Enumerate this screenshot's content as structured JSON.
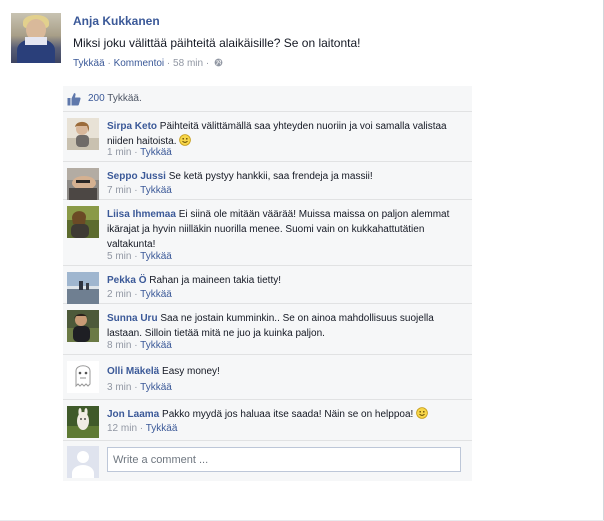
{
  "post": {
    "author": "Anja Kukkanen",
    "text": "Miksi joku välittää päihteitä alaikäisille? Se on laitonta!",
    "like_label": "Tykkää",
    "comment_label": "Kommentoi",
    "separator": " · ",
    "time": "58 min"
  },
  "likes": {
    "count": "200",
    "label": "Tykkää."
  },
  "comments": [
    {
      "name": "Sirpa Keto",
      "text": "Päihteitä välittämällä saa yhteyden nuoriin ja voi samalla valistaa niiden haitoista.",
      "emoticon": "smiley-emoticon",
      "time": "1 min",
      "like_label": "Tykkää"
    },
    {
      "name": "Seppo Jussi",
      "text": "Se ketä pystyy hankkii, saa frendeja ja massii!",
      "time": "7 min",
      "like_label": "Tykkää"
    },
    {
      "name": "Liisa Ihmemaa",
      "text": "Ei siinä ole mitään väärää! Muissa maissa on paljon alemmat ikärajat ja hyvin niilläkin nuorilla menee. Suomi vain on kukkahattutätien valtakunta!",
      "time": "5 min",
      "like_label": "Tykkää"
    },
    {
      "name": "Pekka Ö",
      "text": "Rahan ja maineen takia tietty!",
      "time": "2 min",
      "like_label": "Tykkää"
    },
    {
      "name": "Sunna Uru",
      "text": "Saa ne jostain kumminkin.. Se on ainoa mahdollisuus suojella lastaan. Silloin tietää mitä ne juo ja kuinka paljon.",
      "time": "8 min",
      "like_label": "Tykkää"
    },
    {
      "name": "Olli Mäkelä",
      "text": "Easy money!",
      "time": "3 min",
      "like_label": "Tykkää"
    },
    {
      "name": "Jon Laama",
      "text": "Pakko myydä jos haluaa itse saada! Näin se on helppoa!",
      "emoticon": "smiley-emoticon",
      "time": "12 min",
      "like_label": "Tykkää"
    }
  ],
  "composer": {
    "placeholder": "Write a comment ..."
  },
  "colors": {
    "link": "#3b5998",
    "meta": "#9197a3",
    "panel": "#f6f7f8",
    "border": "#e1e2e3"
  }
}
